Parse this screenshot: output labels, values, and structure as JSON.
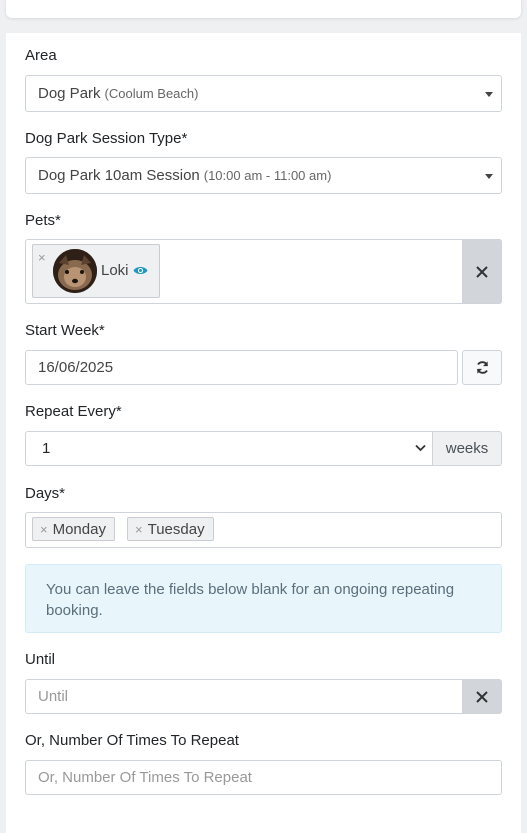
{
  "form": {
    "area": {
      "label": "Area",
      "value": "Dog Park",
      "detail": "(Coolum Beach)"
    },
    "session_type": {
      "label": "Dog Park Session Type*",
      "value": "Dog Park 10am Session",
      "detail": "(10:00 am - 11:00 am)"
    },
    "pets": {
      "label": "Pets*",
      "chip_remove": "×",
      "chips": [
        {
          "name": "Loki"
        }
      ],
      "clear_symbol": "X"
    },
    "start_week": {
      "label": "Start Week*",
      "value": "16/06/2025"
    },
    "repeat_every": {
      "label": "Repeat Every*",
      "value": "1",
      "addon": "weeks"
    },
    "days": {
      "label": "Days*",
      "chips": [
        {
          "remove": "×",
          "name": "Monday"
        },
        {
          "remove": "×",
          "name": "Tuesday"
        }
      ]
    },
    "info": "You can leave the fields below blank for an ongoing repeating booking.",
    "until": {
      "label": "Until",
      "placeholder": "Until",
      "clear_symbol": "X"
    },
    "repeat_times": {
      "label": "Or, Number Of Times To Repeat",
      "placeholder": "Or, Number Of Times To Repeat"
    }
  },
  "colors": {
    "accent": "#2196c4",
    "clear_button": "#d2d6db",
    "info_bg": "#e8f5fb"
  }
}
